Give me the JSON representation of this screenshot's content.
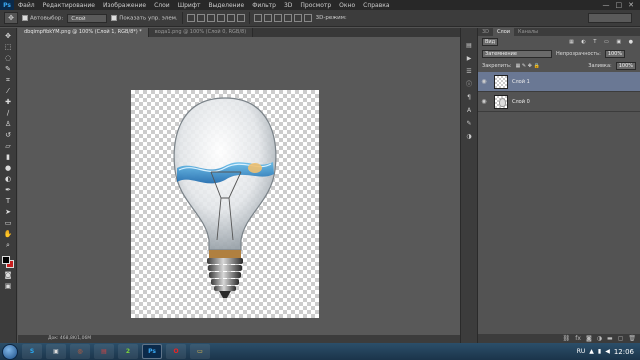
{
  "app": {
    "logo": "Ps"
  },
  "menu": [
    "Файл",
    "Редактирование",
    "Изображение",
    "Слои",
    "Шрифт",
    "Выделение",
    "Фильтр",
    "3D",
    "Просмотр",
    "Окно",
    "Справка"
  ],
  "window_controls": [
    "—",
    "□",
    "✕"
  ],
  "options": {
    "autoselect_label": "Автовыбор:",
    "autoselect_value": "Слой",
    "show_controls_label": "Показать упр. элем.",
    "mode_3d_label": "3D-режим:"
  },
  "tabs": [
    {
      "label": "dbqimpfibkYM.png @ 100% (Слой 1, RGB/8*) *",
      "active": true
    },
    {
      "label": "вода1.png @ 100% (Слой 0, RGB/8)",
      "active": false
    }
  ],
  "status": {
    "doc": "Док: 468,8K/1,06M"
  },
  "layers_panel": {
    "tabs": [
      "3D",
      "Слои",
      "Каналы"
    ],
    "kind_label": "Вид",
    "blend_mode": "Затемнение",
    "opacity_label": "Непрозрачность:",
    "opacity_value": "100%",
    "lock_label": "Закрепить:",
    "fill_label": "Заливка:",
    "fill_value": "100%",
    "layers": [
      {
        "name": "Слой 1",
        "selected": true
      },
      {
        "name": "Слой 0",
        "selected": false
      }
    ]
  },
  "taskbar": {
    "language": "RU",
    "clock": "12:06"
  },
  "colors": {
    "foreground": "#000000",
    "background": "#c81e1e",
    "selection": "#6a7894"
  }
}
